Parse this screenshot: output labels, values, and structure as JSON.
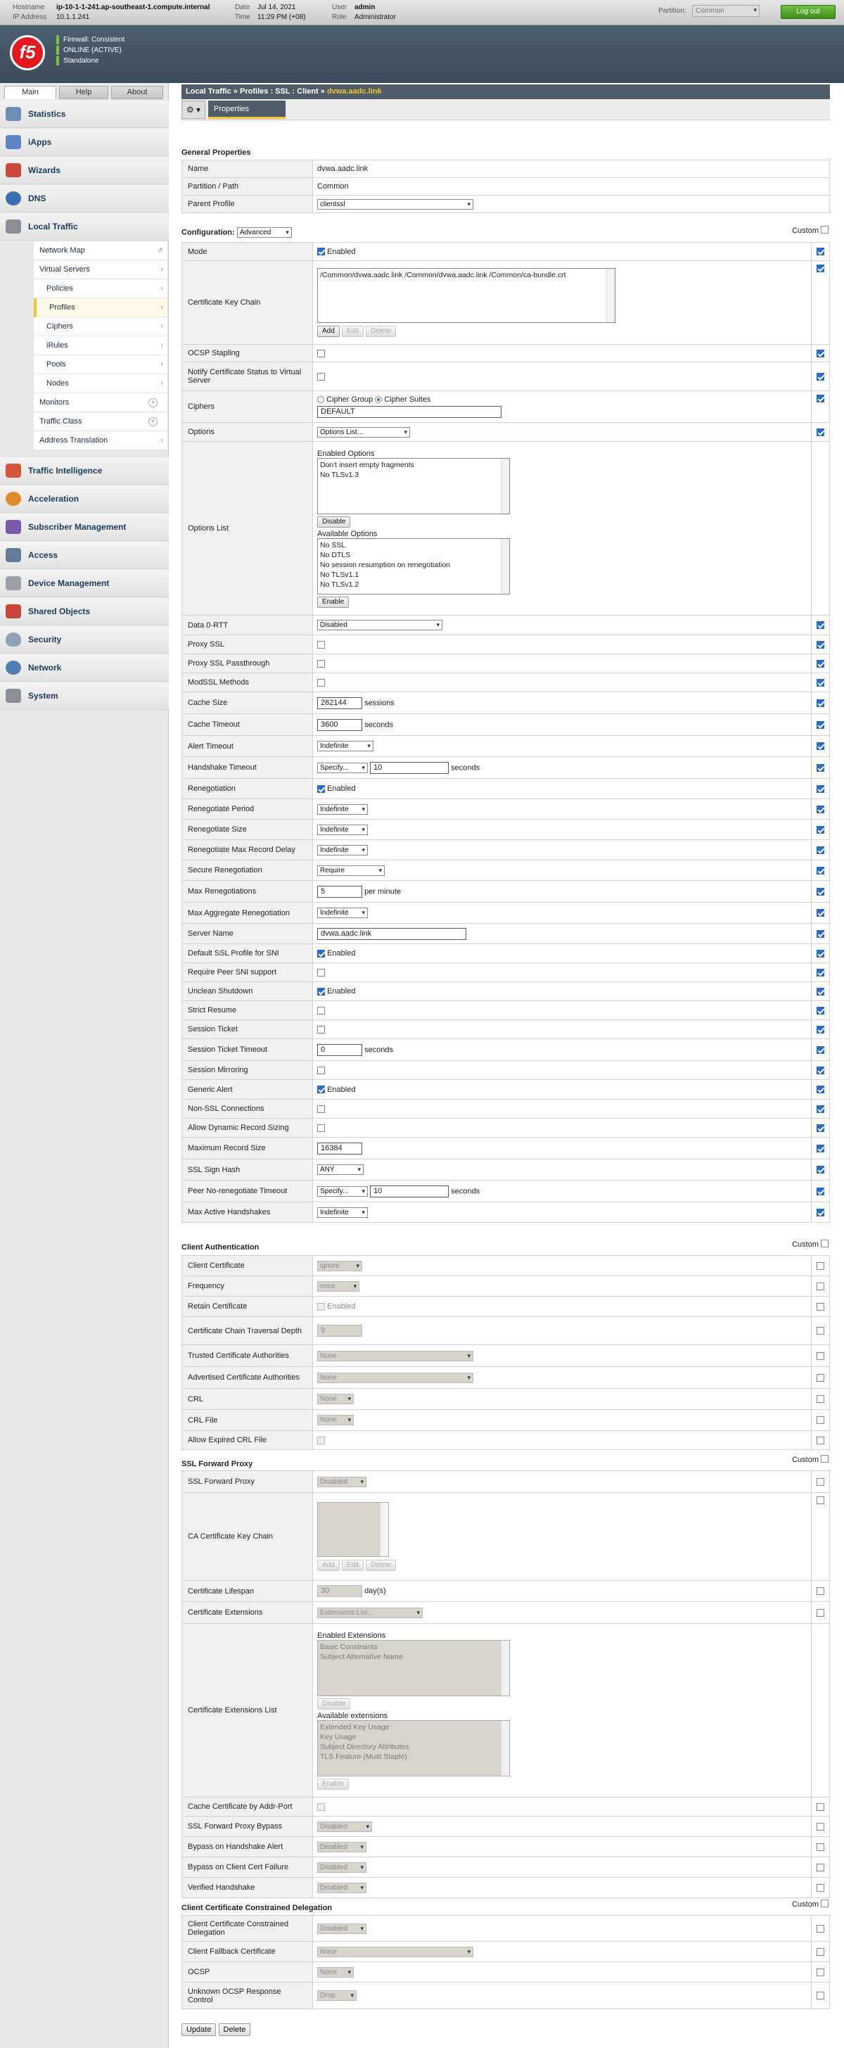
{
  "top": {
    "hostname_label": "Hostname",
    "hostname": "ip-10-1-1-241.ap-southeast-1.compute.internal",
    "ip_label": "IP Address",
    "ip": "10.1.1.241",
    "date_label": "Date",
    "date": "Jul 14, 2021",
    "time_label": "Time",
    "time": "11:29 PM (+08)",
    "user_label": "User",
    "user": "admin",
    "role_label": "Role",
    "role": "Administrator",
    "partition_label": "Partition:",
    "partition": "Common",
    "logout": "Log out"
  },
  "banner": {
    "logo": "f5",
    "status": [
      "Firewall: Consistent",
      "ONLINE (ACTIVE)",
      "Standalone"
    ],
    "status_color": "#7cc142"
  },
  "nav": {
    "tabs": [
      "Main",
      "Help",
      "About"
    ],
    "items": [
      "Statistics",
      "iApps",
      "Wizards",
      "DNS",
      "Local Traffic"
    ],
    "local_traffic_sub": [
      "Network Map",
      "Virtual Servers"
    ],
    "virtual_servers_sub": [
      "Policies",
      "Profiles",
      "Ciphers",
      "iRules",
      "Pools",
      "Nodes"
    ],
    "local_traffic_more": [
      "Monitors",
      "Traffic Class",
      "Address Translation"
    ],
    "items2": [
      "Traffic Intelligence",
      "Acceleration",
      "Subscriber Management",
      "Access",
      "Device Management",
      "Shared Objects",
      "Security",
      "Network",
      "System"
    ]
  },
  "crumb": {
    "a": "Local Traffic",
    "sep": "»",
    "b": "Profiles : SSL : Client",
    "c": "dvwa.aadc.link"
  },
  "tabs": {
    "gear": "⚙ ▾",
    "properties": "Properties"
  },
  "general": {
    "title": "General Properties",
    "name_label": "Name",
    "name": "dvwa.aadc.link",
    "partition_label": "Partition / Path",
    "partition": "Common",
    "parent_label": "Parent Profile",
    "parent": "clientssl"
  },
  "config": {
    "title": "Configuration:",
    "mode_select": "Advanced",
    "custom": "Custom",
    "mode_label": "Mode",
    "enabled": "Enabled",
    "ckc_label": "Certificate Key Chain",
    "ckc_value": "/Common/dvwa.aadc.link /Common/dvwa.aadc.link /Common/ca-bundle.crt",
    "add": "Add",
    "edit": "Edit",
    "delete": "Delete",
    "ocsp_label": "OCSP Stapling",
    "notify_label": "Notify Certificate Status to Virtual Server",
    "ciphers_label": "Ciphers",
    "cipher_group": "Cipher Group",
    "cipher_suites": "Cipher Suites",
    "ciphers_value": "DEFAULT",
    "options_label": "Options",
    "options_value": "Options List...",
    "options_list_label": "Options List",
    "enabled_options_title": "Enabled Options",
    "enabled_options": [
      "Don't insert empty fragments",
      "No TLSv1.3"
    ],
    "disable": "Disable",
    "available_options_title": "Available Options",
    "available_options": [
      "No SSL",
      "No DTLS",
      "No session resumption on renegotiation",
      "No TLSv1.1",
      "No TLSv1.2"
    ],
    "enable": "Enable",
    "data0rtt_label": "Data 0-RTT",
    "data0rtt": "Disabled",
    "proxyssl_label": "Proxy SSL",
    "proxyssl_pt_label": "Proxy SSL Passthrough",
    "modssl_label": "ModSSL Methods",
    "cache_size_label": "Cache Size",
    "cache_size": "262144",
    "sessions": "sessions",
    "cache_timeout_label": "Cache Timeout",
    "cache_timeout": "3600",
    "seconds": "seconds",
    "alert_timeout_label": "Alert Timeout",
    "alert_timeout": "Indefinite",
    "handshake_timeout_label": "Handshake Timeout",
    "specify": "Specify...",
    "handshake_timeout": "10",
    "reneg_label": "Renegotiation",
    "reneg_period_label": "Renegotiate Period",
    "indefinite": "Indefinite",
    "reneg_size_label": "Renegotiate Size",
    "reneg_max_delay_label": "Renegotiate Max Record Delay",
    "secure_reneg_label": "Secure Renegotiation",
    "secure_reneg": "Require",
    "max_reneg_label": "Max Renegotiations",
    "max_reneg": "5",
    "per_minute": "per minute",
    "max_agg_reneg_label": "Max Aggregate Renegotiation",
    "server_name_label": "Server Name",
    "server_name": "dvwa.aadc.link",
    "default_sni_label": "Default SSL Profile for SNI",
    "require_peer_sni_label": "Require Peer SNI support",
    "unclean_label": "Unclean Shutdown",
    "strict_resume_label": "Strict Resume",
    "session_ticket_label": "Session Ticket",
    "session_ticket_timeout_label": "Session Ticket Timeout",
    "session_ticket_timeout": "0",
    "session_mirroring_label": "Session Mirroring",
    "generic_alert_label": "Generic Alert",
    "non_ssl_label": "Non-SSL Connections",
    "dyn_record_label": "Allow Dynamic Record Sizing",
    "max_record_label": "Maximum Record Size",
    "max_record": "16384",
    "sign_hash_label": "SSL Sign Hash",
    "sign_hash": "ANY",
    "peer_noreneg_label": "Peer No-renegotiate Timeout",
    "peer_noreneg": "10",
    "max_active_label": "Max Active Handshakes"
  },
  "client_auth": {
    "title": "Client Authentication",
    "custom": "Custom",
    "client_cert_label": "Client Certificate",
    "client_cert": "ignore",
    "frequency_label": "Frequency",
    "frequency": "once",
    "retain_label": "Retain Certificate",
    "enabled": "Enabled",
    "depth_label": "Certificate Chain Traversal Depth",
    "depth": "9",
    "trusted_label": "Trusted Certificate Authorities",
    "none": "None",
    "advertised_label": "Advertised Certificate Authorities",
    "crl_label": "CRL",
    "crl_file_label": "CRL File",
    "allow_expired_label": "Allow Expired CRL File"
  },
  "fwd_proxy": {
    "title": "SSL Forward Proxy",
    "custom": "Custom",
    "proxy_label": "SSL Forward Proxy",
    "disabled": "Disabled",
    "ca_ckc_label": "CA Certificate Key Chain",
    "add": "Add",
    "edit": "Edit",
    "delete": "Delete",
    "lifespan_label": "Certificate Lifespan",
    "lifespan": "30",
    "days": "day(s)",
    "ext_label": "Certificate Extensions",
    "ext_value": "Extensions List...",
    "ext_list_label": "Certificate Extensions List",
    "enabled_ext_title": "Enabled Extensions",
    "enabled_ext": [
      "Basic Constraints",
      "Subject Alternative Name"
    ],
    "disable": "Disable",
    "available_ext_title": "Available extensions",
    "available_ext": [
      "Extended Key Usage",
      "Key Usage",
      "Subject Directory Attributes",
      "TLS Feature (Must Staple)"
    ],
    "enable": "Enable",
    "cache_addr_label": "Cache Certificate by Addr-Port",
    "bypass_label": "SSL Forward Proxy Bypass",
    "bypass_alert_label": "Bypass on Handshake Alert",
    "bypass_cert_label": "Bypass on Client Cert Failure",
    "verified_label": "Verified Handshake"
  },
  "delegation": {
    "title": "Client Certificate Constrained Delegation",
    "custom": "Custom",
    "ccd_label": "Client Certificate Constrained Delegation",
    "disabled": "Disabled",
    "fallback_label": "Client Fallback Certificate",
    "none": "None",
    "ocsp_label": "OCSP",
    "unknown_label": "Unknown OCSP Response Control",
    "unknown": "Drop"
  },
  "buttons": {
    "update": "Update",
    "delete": "Delete"
  }
}
